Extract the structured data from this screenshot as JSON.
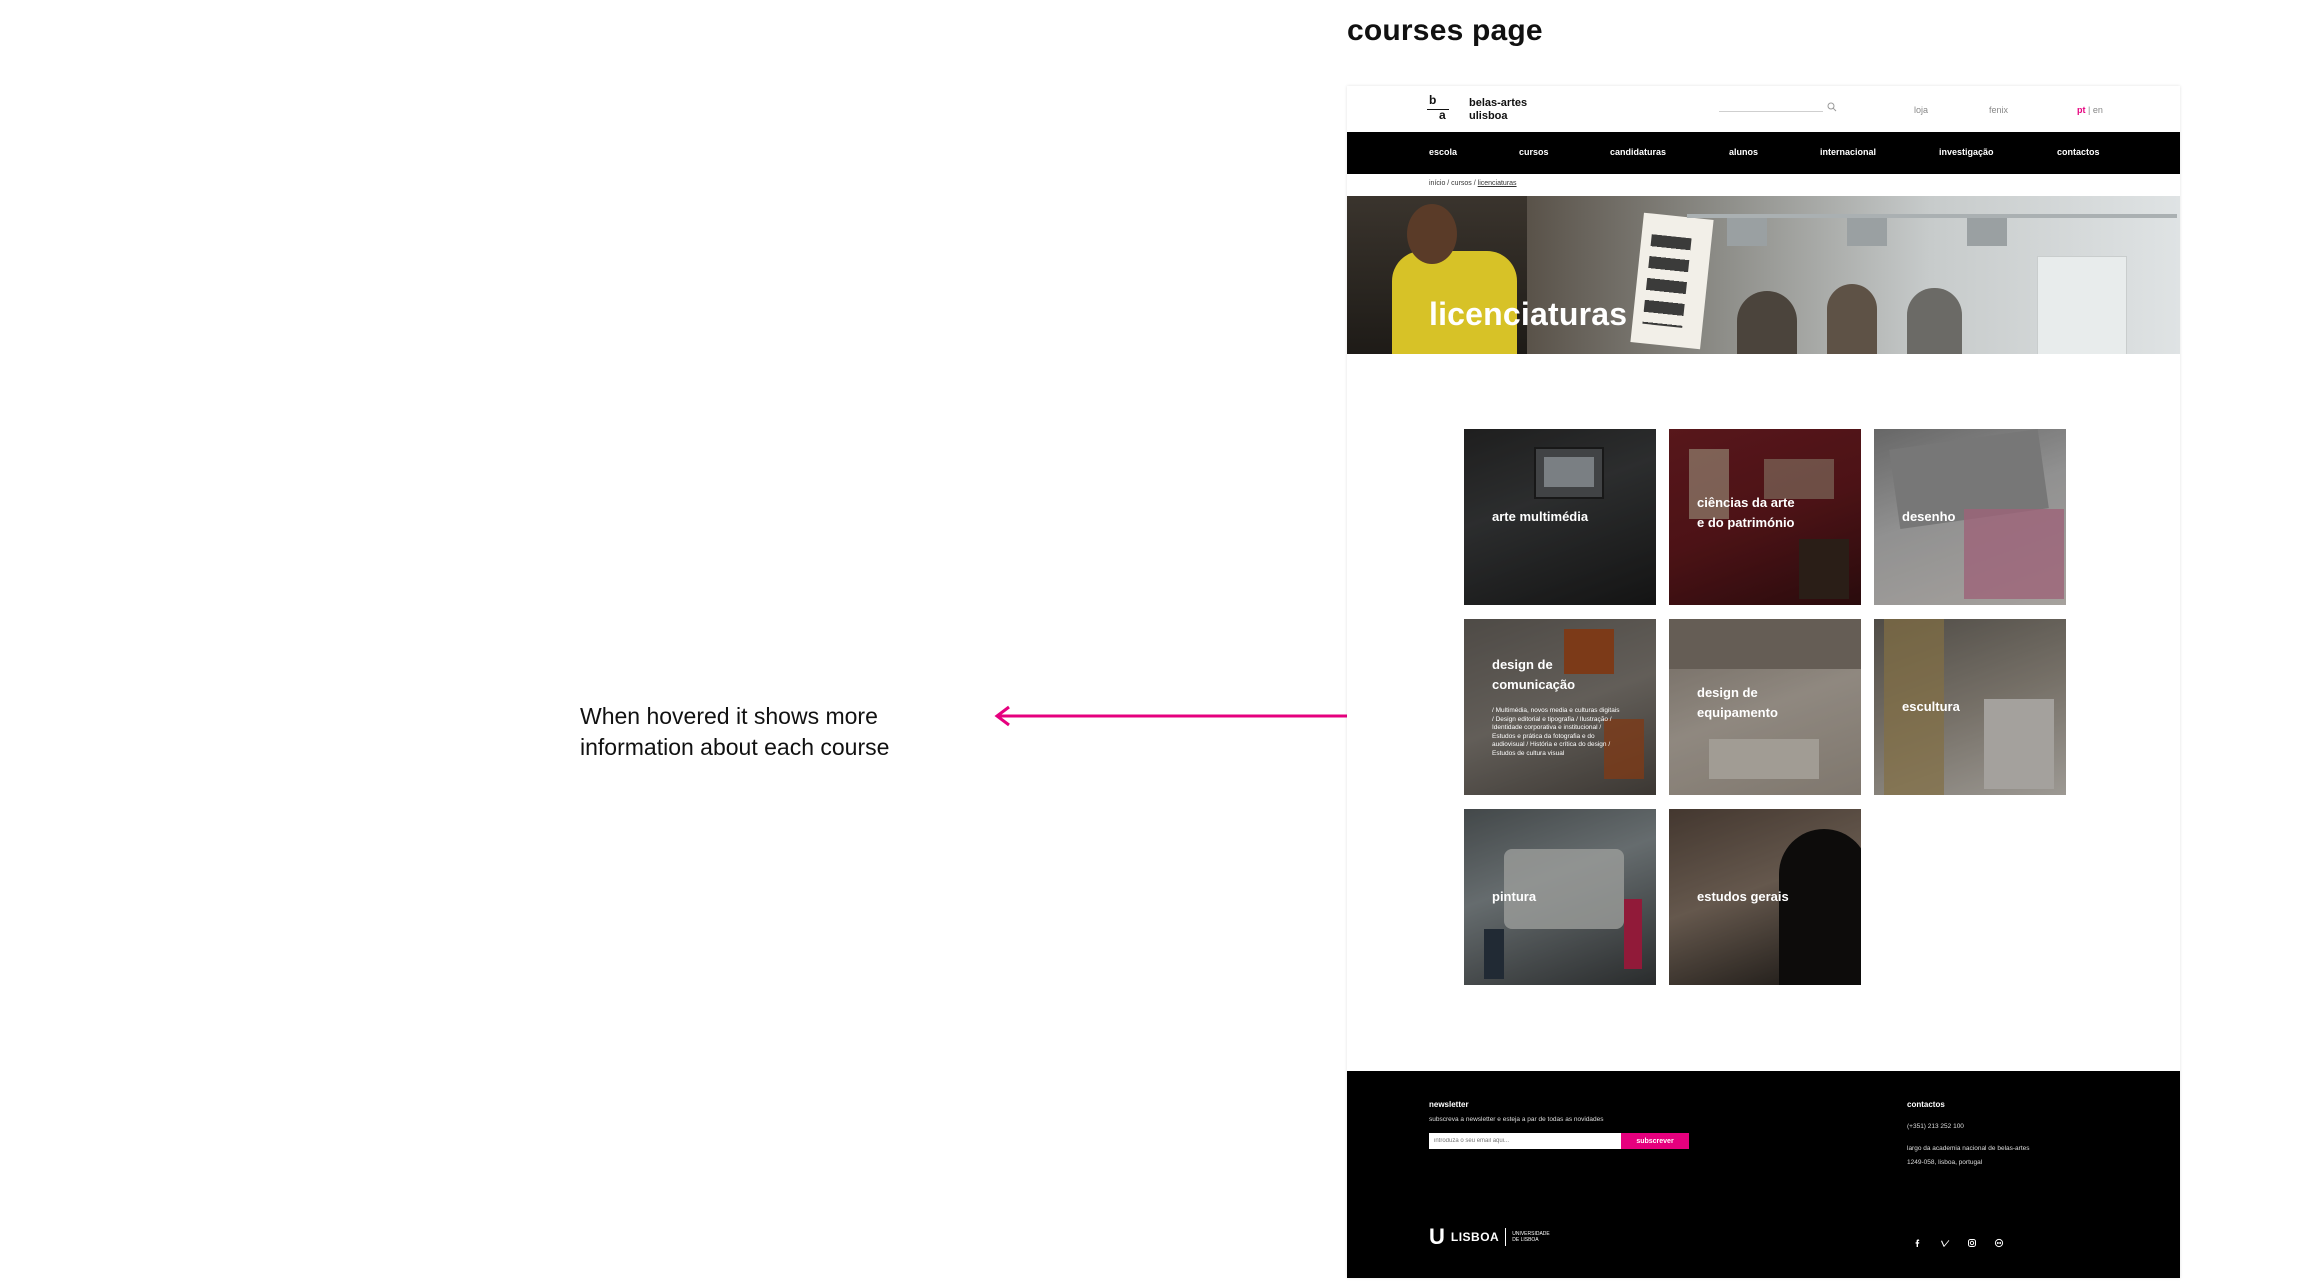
{
  "presentation": {
    "title": "courses page",
    "annotation": "When hovered it shows more information about each course",
    "arrow_color": "#e6007e"
  },
  "header": {
    "logo_b": "b",
    "logo_a": "a",
    "logo_line1": "belas-artes",
    "logo_line2": "ulisboa",
    "links": [
      "loja",
      "fenix"
    ],
    "lang_active": "pt",
    "lang_separator": " | ",
    "lang_other": "en"
  },
  "nav": {
    "items": [
      "escola",
      "cursos",
      "candidaturas",
      "alunos",
      "internacional",
      "investigação",
      "contactos"
    ]
  },
  "breadcrumb": {
    "prefix": "início / cursos / ",
    "current": "licenciaturas"
  },
  "hero": {
    "title": "licenciaturas"
  },
  "courses": [
    {
      "line1": "arte multimédia",
      "line2": ""
    },
    {
      "line1": "ciências da arte",
      "line2": "e do património"
    },
    {
      "line1": "desenho",
      "line2": ""
    },
    {
      "line1": "design de",
      "line2": "comunicação",
      "description": "/ Multimédia, novos media e culturas digitais / Design editorial e tipografia / Ilustração / Identidade corporativa e institucional / Estudos e prática da fotografia e do audiovisual / História e crítica do design / Estudos de cultura visual"
    },
    {
      "line1": "design de",
      "line2": "equipamento"
    },
    {
      "line1": "escultura",
      "line2": ""
    },
    {
      "line1": "pintura",
      "line2": ""
    },
    {
      "line1": "estudos gerais",
      "line2": ""
    }
  ],
  "footer": {
    "newsletter_title": "newsletter",
    "newsletter_sub": "subscreva a newsletter e esteja a par de todas as novidades",
    "newsletter_placeholder": "introduza o seu email aqui...",
    "subscribe_label": "subscrever",
    "contacts_title": "contactos",
    "phone": "(+351) 213 252 100",
    "address_line1": "largo da academia nacional de belas-artes",
    "address_line2": "1249-058, lisboa, portugal",
    "ul_logo": "LISBOA",
    "ul_sub": "UNIVERSIDADE DE LISBOA",
    "social_icons": [
      "facebook-icon",
      "vimeo-icon",
      "instagram-icon",
      "flickr-icon"
    ]
  },
  "colors": {
    "accent": "#e6007e",
    "nav_bg": "#000000",
    "footer_bg": "#000000"
  }
}
